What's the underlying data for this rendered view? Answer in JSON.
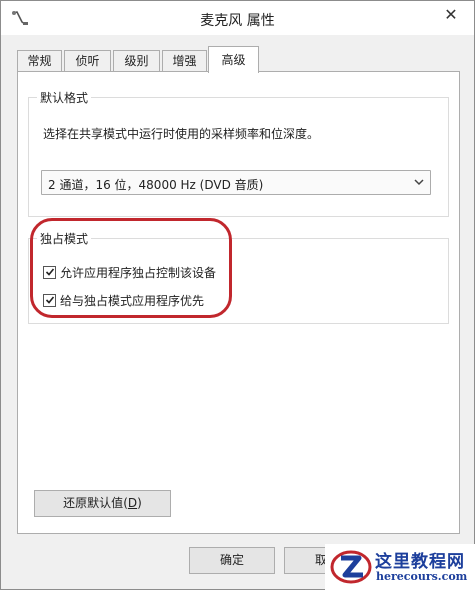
{
  "window": {
    "title": "麦克风 属性",
    "close_glyph": "✕"
  },
  "tabs": [
    {
      "label": "常规",
      "active": false
    },
    {
      "label": "侦听",
      "active": false
    },
    {
      "label": "级别",
      "active": false
    },
    {
      "label": "增强",
      "active": false
    },
    {
      "label": "高级",
      "active": true
    }
  ],
  "default_format": {
    "title": "默认格式",
    "description": "选择在共享模式中运行时使用的采样频率和位深度。",
    "selected": "2 通道，16 位，48000 Hz (DVD 音质)"
  },
  "exclusive_mode": {
    "title": "独占模式",
    "options": [
      {
        "label": "允许应用程序独占控制该设备",
        "checked": true
      },
      {
        "label": "给与独占模式应用程序优先",
        "checked": true
      }
    ]
  },
  "restore_button": {
    "label": "还原默认值",
    "mnemonic": "D"
  },
  "footer": {
    "ok_label": "确定",
    "cancel_label_partial": "取"
  },
  "watermark": {
    "line1": "这里教程网",
    "line2": "herecours.com"
  },
  "colors": {
    "annotation_ring": "#c1272d",
    "watermark_blue": "#1d3f9c"
  },
  "icons": {
    "app": "microphone-icon",
    "close": "close-icon",
    "dropdown": "chevron-down-icon",
    "check": "checkmark-icon"
  }
}
